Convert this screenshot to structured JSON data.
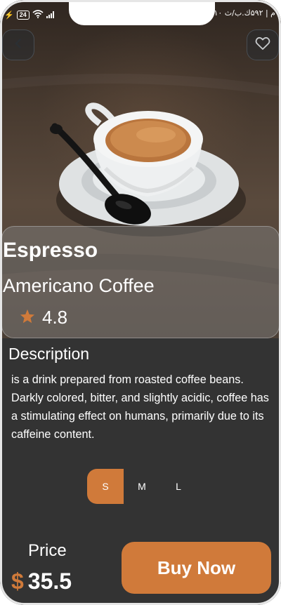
{
  "status_bar": {
    "battery": "24",
    "right_text": "۷:۱۰ م | ۵۹۲ك.ب/ث"
  },
  "product": {
    "title": "Espresso",
    "subtitle": "Americano Coffee",
    "rating": "4.8"
  },
  "description": {
    "heading": "Description",
    "text": "is a drink prepared from roasted coffee beans. Darkly colored, bitter, and slightly acidic, coffee has a stimulating effect on humans, primarily due to its caffeine content."
  },
  "sizes": {
    "options": [
      "S",
      "M",
      "L"
    ],
    "selected": "S"
  },
  "footer": {
    "price_label": "Price",
    "currency": "$",
    "price": "35.5",
    "buy_label": "Buy Now"
  },
  "colors": {
    "accent": "#d07a3a",
    "background": "#333333"
  },
  "icons": {
    "back": "chevron-left-icon",
    "favorite": "heart-outline-icon",
    "rating": "star-icon",
    "signal": "wifi-icon"
  }
}
